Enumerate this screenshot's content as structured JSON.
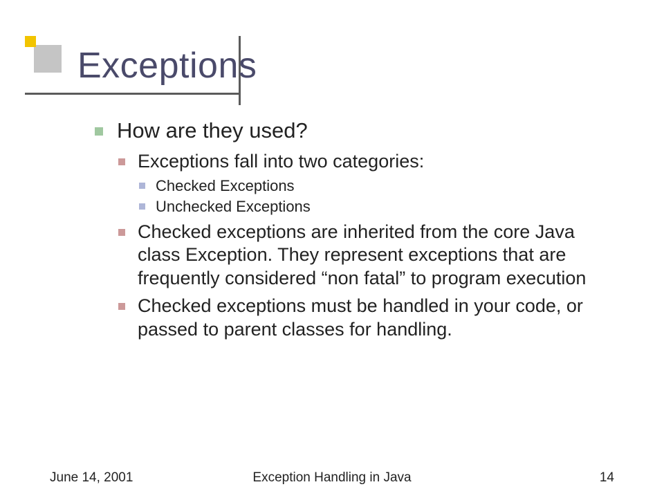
{
  "title": "Exceptions",
  "body": {
    "lvl1": [
      {
        "text": "How are they used?",
        "lvl2": [
          {
            "text": "Exceptions fall into two categories:",
            "lvl3": [
              {
                "text": "Checked Exceptions"
              },
              {
                "text": "Unchecked Exceptions"
              }
            ]
          },
          {
            "text": "Checked exceptions are inherited from the core Java class Exception. They represent exceptions that are frequently considered “non fatal” to program execution"
          },
          {
            "text": "Checked exceptions must be handled in your code, or passed to parent classes for handling."
          }
        ]
      }
    ]
  },
  "footer": {
    "date": "June 14, 2001",
    "center": "Exception Handling in Java",
    "page": "14"
  }
}
